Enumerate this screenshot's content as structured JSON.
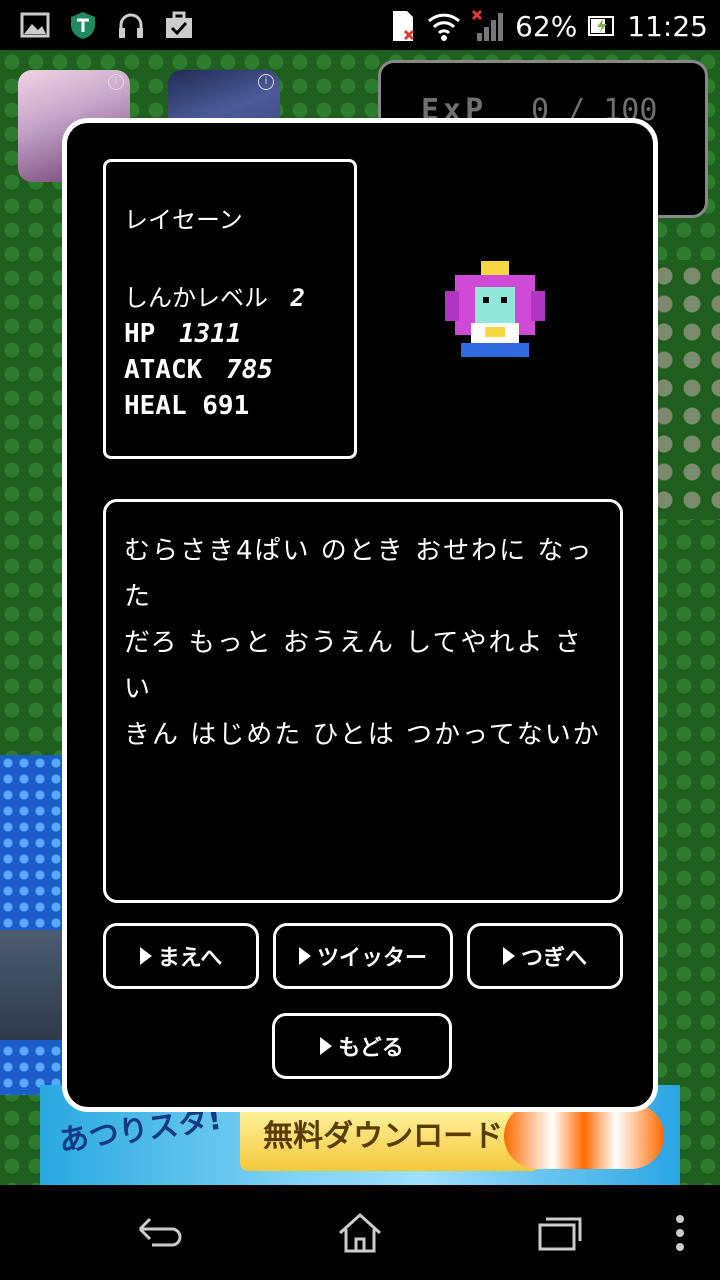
{
  "status_bar": {
    "battery_percent": "62%",
    "time": "11:25",
    "icons": [
      "image-icon",
      "vpn-shield-icon",
      "headset-icon",
      "briefcase-check-icon",
      "sim-error-icon",
      "wifi-icon",
      "no-signal-icon",
      "battery-charging-icon"
    ]
  },
  "game": {
    "exp_label": "ExP",
    "exp_value": "0 / 100"
  },
  "dialog": {
    "character_name": "レイセーン",
    "level_label": "しんかレベル",
    "level_value": "2",
    "hp_label": "HP",
    "hp_value": "1311",
    "attack_label": "ATACK",
    "attack_value": "785",
    "partial_stat": "HEAL 691",
    "message_lines": [
      "むらさき4ぱい のとき おせわに なった",
      "だろ もっと おうえん してやれよ さい",
      "きん はじめた ひとは つかってないか"
    ],
    "buttons": {
      "prev": "まえへ",
      "twitter": "ツイッター",
      "next": "つぎへ",
      "back": "もどる"
    }
  },
  "ad": {
    "logo": "あつりスタ!",
    "cta": "無料ダウンロード!"
  },
  "navbar": {
    "icons": [
      "back-icon",
      "home-icon",
      "recent-apps-icon",
      "menu-icon"
    ]
  }
}
